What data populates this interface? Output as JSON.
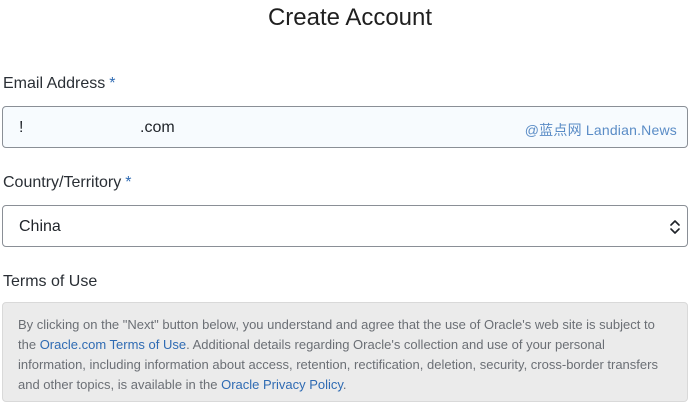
{
  "page": {
    "title": "Create Account"
  },
  "email": {
    "label": "Email Address",
    "required_mark": "*",
    "value_prefix": "!",
    "value_suffix": ".com",
    "watermark": "@蓝点网 Landian.News"
  },
  "country": {
    "label": "Country/Territory",
    "required_mark": "*",
    "selected": "China",
    "icon": "updown-chevron-icon"
  },
  "terms": {
    "heading": "Terms of Use",
    "text_1": "By clicking on the \"Next\" button below, you understand and agree that the use of Oracle's web site is subject to the ",
    "link_1": "Oracle.com Terms of Use",
    "text_2": ". Additional details regarding Oracle's collection and use of your personal information, including information about access, retention, rectification, deletion, security, cross-border transfers and other topics, is available in the ",
    "link_2": "Oracle Privacy Policy",
    "text_3": "."
  },
  "colors": {
    "accent": "#2f6bb3",
    "terms_background": "#ebebeb",
    "field_border": "#8a8f96"
  }
}
